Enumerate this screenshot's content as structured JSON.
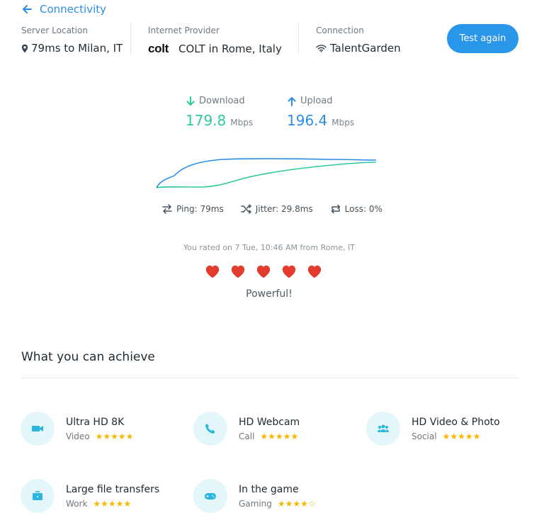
{
  "header": {
    "back_label": "Connectivity",
    "server": {
      "label": "Server Location",
      "value": "79ms to Milan, IT"
    },
    "provider": {
      "label": "Internet Provider",
      "logo_text": "colt",
      "value": "COLT in Rome, Italy"
    },
    "connection": {
      "label": "Connection",
      "value": "TalentGarden"
    },
    "test_button": "Test again"
  },
  "speeds": {
    "download": {
      "label": "Download",
      "value": "179.8",
      "unit": "Mbps"
    },
    "upload": {
      "label": "Upload",
      "value": "196.4",
      "unit": "Mbps"
    }
  },
  "colors": {
    "upload": "#2b8ee6",
    "download": "#2fc9a0",
    "heart": "#e33b2e",
    "star": "#f5b800",
    "button": "#2a96ea"
  },
  "stats": {
    "ping": {
      "label": "Ping:",
      "value": "79",
      "unit": "ms"
    },
    "jitter": {
      "label": "Jitter:",
      "value": "29.8",
      "unit": "ms"
    },
    "loss": {
      "label": "Loss:",
      "value": "0",
      "unit": "%"
    }
  },
  "rating": {
    "text": "You rated on 7 Tue, 10:46 AM from Rome, IT",
    "hearts": 5,
    "verdict": "Powerful!"
  },
  "achieve": {
    "title": "What you can achieve",
    "items": [
      {
        "title": "Ultra HD 8K",
        "category": "Video",
        "stars": "★★★★★",
        "icon": "video-camera-icon"
      },
      {
        "title": "HD Webcam",
        "category": "Call",
        "stars": "★★★★★",
        "icon": "phone-icon"
      },
      {
        "title": "HD Video & Photo",
        "category": "Social",
        "stars": "★★★★★",
        "icon": "users-icon"
      },
      {
        "title": "Large file transfers",
        "category": "Work",
        "stars": "★★★★★",
        "icon": "briefcase-icon"
      },
      {
        "title": "In the game",
        "category": "Gaming",
        "stars": "★★★★☆",
        "icon": "gamepad-icon"
      }
    ]
  }
}
